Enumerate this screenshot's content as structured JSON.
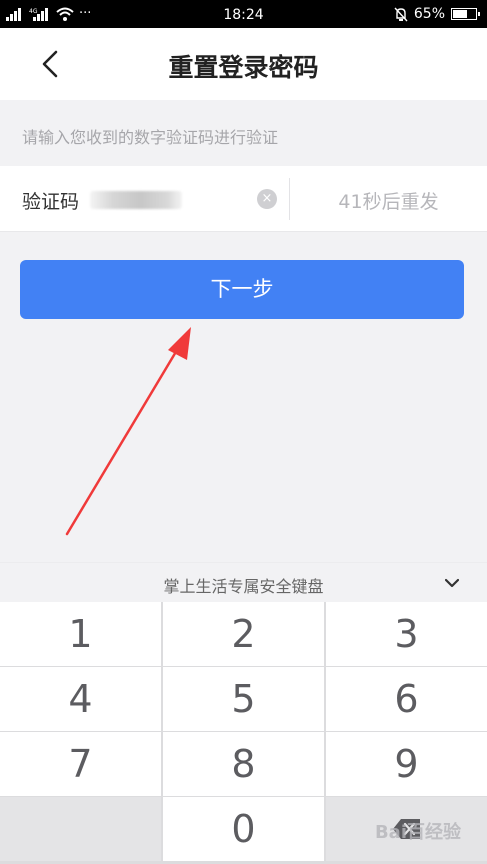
{
  "status_bar": {
    "signal_icons": [
      "signal-icon",
      "4g-signal-icon",
      "wifi-icon"
    ],
    "dots": "···",
    "time": "18:24",
    "battery_percent": "65%",
    "battery_level": 0.65
  },
  "nav": {
    "back_icon": "chevron-left-icon",
    "title": "重置登录密码"
  },
  "form": {
    "hint": "请输入您收到的数字验证码进行验证",
    "code_label": "验证码",
    "resend_label": "41秒后重发"
  },
  "next_button": {
    "label": "下一步"
  },
  "keyboard": {
    "title": "掌上生活专属安全键盘",
    "collapse_icon": "chevron-down-icon",
    "keys": [
      "1",
      "2",
      "3",
      "4",
      "5",
      "6",
      "7",
      "8",
      "9",
      "",
      "0",
      "backspace-icon"
    ]
  },
  "colors": {
    "accent": "#4281f4",
    "annotation_arrow": "#f03a3a"
  }
}
